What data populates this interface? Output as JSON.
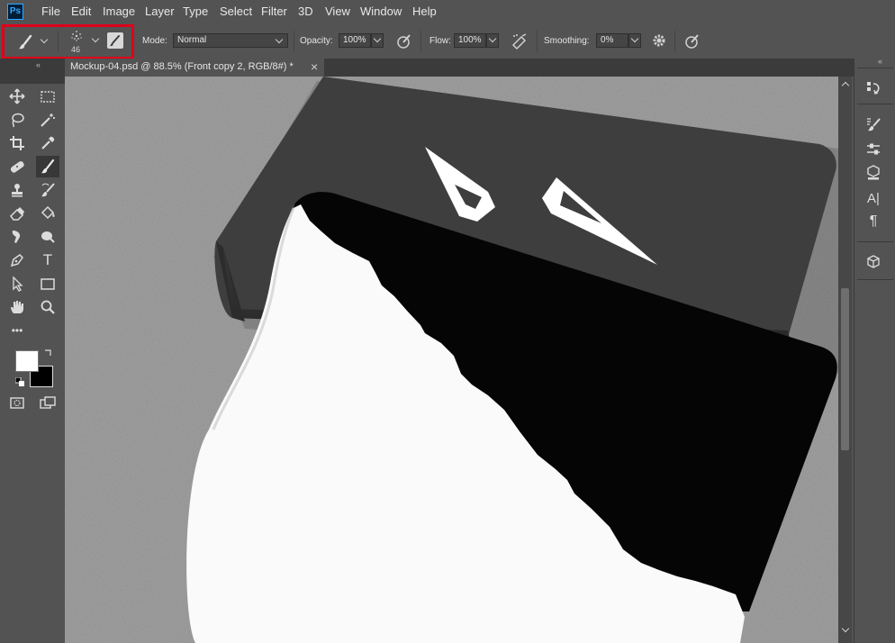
{
  "app": {
    "logo": "Ps"
  },
  "menu": [
    "File",
    "Edit",
    "Image",
    "Layer",
    "Type",
    "Select",
    "Filter",
    "3D",
    "View",
    "Window",
    "Help"
  ],
  "options": {
    "brush_size": "46",
    "mode_label": "Mode:",
    "mode_value": "Normal",
    "opacity_label": "Opacity:",
    "opacity_value": "100%",
    "flow_label": "Flow:",
    "flow_value": "100%",
    "smoothing_label": "Smoothing:",
    "smoothing_value": "0%"
  },
  "document_tab": {
    "title": "Mockup-04.psd @ 88.5% (Front copy 2, RGB/8#) *",
    "close": "×"
  },
  "toolbar": {
    "tools": [
      "move-tool",
      "marquee-tool",
      "lasso-tool",
      "magic-wand-tool",
      "crop-tool",
      "eyedropper-tool",
      "healing-brush-tool",
      "brush-tool",
      "clone-stamp-tool",
      "history-brush-tool",
      "eraser-tool",
      "paint-bucket-tool",
      "smudge-tool",
      "dodge-tool",
      "pen-tool",
      "type-tool",
      "path-selection-tool",
      "rectangle-tool",
      "hand-tool",
      "zoom-tool"
    ],
    "active_tool": "brush-tool",
    "type_glyph": "T",
    "more_glyph": "•••",
    "foreground_color": "#ffffff",
    "background_color": "#000000"
  },
  "right_panel": {
    "icons": [
      "history-icon",
      "brush-settings-icon",
      "adjustments-icon",
      "libraries-icon",
      "character-icon",
      "paragraph-icon",
      "3d-icon"
    ],
    "character_glyph": "A|",
    "paragraph_glyph": "¶"
  },
  "colors": {
    "ui_bg": "#535353",
    "highlight": "#e0001a",
    "canvas_bg": "#8a8a8a"
  }
}
